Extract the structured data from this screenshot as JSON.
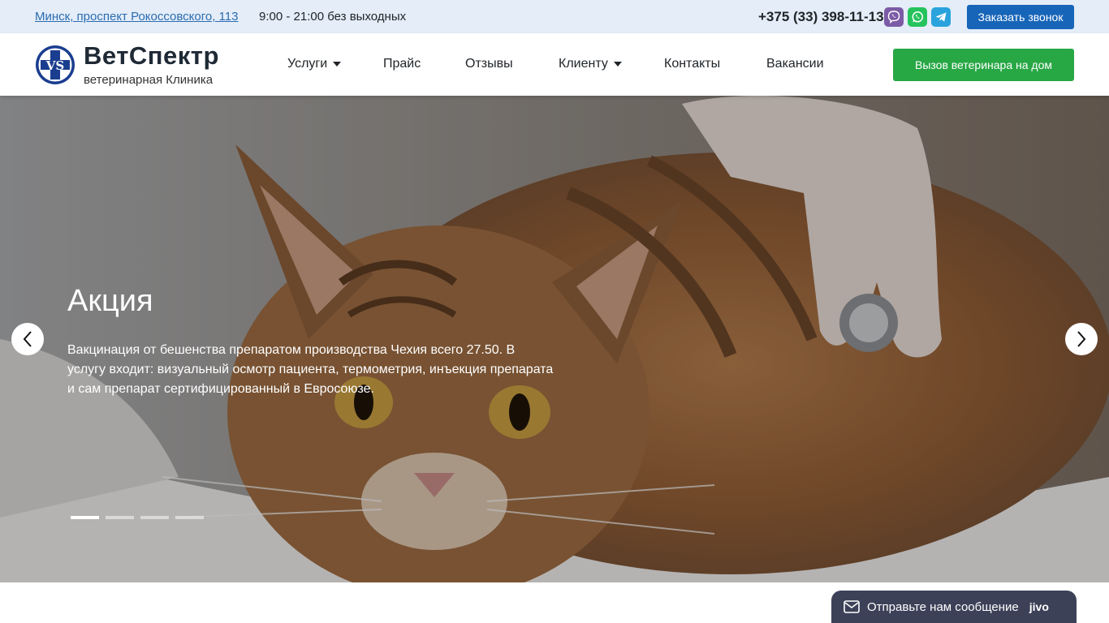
{
  "topbar": {
    "address": "Минск, проспект Рокоссовского, 113",
    "hours": "9:00 - 21:00 без выходных",
    "phone": "+375 (33) 398-11-13",
    "messengers": [
      "viber-icon",
      "whatsapp-icon",
      "telegram-icon"
    ],
    "callback_label": "Заказать звонок"
  },
  "header": {
    "logo_title": "ВетСпектр",
    "logo_subtitle": "ветеринарная Клиника",
    "nav": [
      {
        "label": "Услуги",
        "dropdown": true
      },
      {
        "label": "Прайс",
        "dropdown": false
      },
      {
        "label": "Отзывы",
        "dropdown": false
      },
      {
        "label": "Клиенту",
        "dropdown": true
      },
      {
        "label": "Контакты",
        "dropdown": false
      },
      {
        "label": "Вакансии",
        "dropdown": false
      }
    ],
    "vet_button_label": "Вызов ветеринара на дом"
  },
  "hero": {
    "title": "Акция",
    "text": "Вакцинация от бешенства препаратом производства Чехия всего 27.50. В услугу входит: визуальный осмотр пациента, термометрия, инъекция препарата и сам препарат сертифицированный в Евросоюзе.",
    "slides_count": 4,
    "active_slide": 1
  },
  "chat": {
    "label": "Отправьте нам сообщение",
    "brand": "jivo"
  },
  "colors": {
    "topbar_bg": "#e4edf8",
    "callback_bg": "#1765b8",
    "vet_button_bg": "#28a745",
    "logo_blue": "#1a3d8f",
    "chat_bg": "#3c4158"
  }
}
